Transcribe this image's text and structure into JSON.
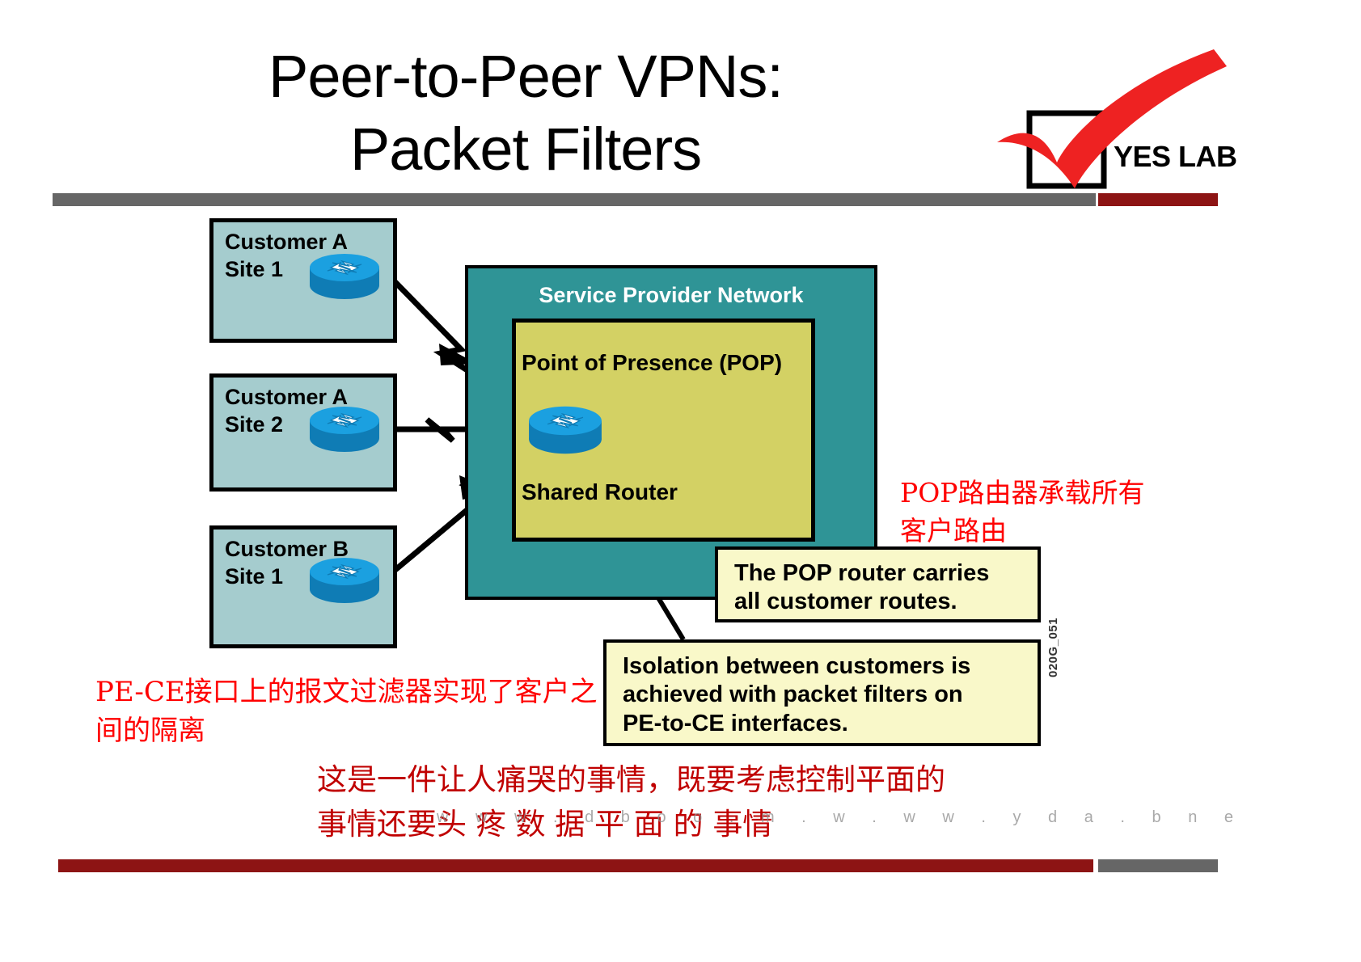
{
  "slide": {
    "title_line1": "Peer-to-Peer VPNs:",
    "title_line2": "Packet Filters",
    "slide_code": "020G_051",
    "watermark": "w w w . d b o o . m . w . w w . y d a . b n e"
  },
  "logo": {
    "text": "YES LAB",
    "accent_color": "#ee2222",
    "box_color": "#000000"
  },
  "rules": {
    "header_left_color": "#666666",
    "header_right_color": "#8d1414",
    "footer_left_color": "#8d1414",
    "footer_right_color": "#666666"
  },
  "diagram": {
    "customers": [
      {
        "label": "Customer A\nSite 1",
        "icon": "router-icon"
      },
      {
        "label": "Customer A\nSite 2",
        "icon": "router-icon"
      },
      {
        "label": "Customer B\nSite 1",
        "icon": "router-icon"
      }
    ],
    "sp_network_label": "Service Provider Network",
    "pop_label": "Point of Presence (POP)",
    "shared_router_label": "Shared Router",
    "shared_router_icon": "router-icon",
    "colors": {
      "customer_box": "#a5ccce",
      "sp_network": "#2f9496",
      "pop_box": "#d3d164",
      "callout": "#f9f8c9",
      "router_top": "#1ba0e0",
      "router_body": "#0f7cb5"
    }
  },
  "callouts": [
    {
      "id": "pop-routes",
      "text": "The POP router carries\nall customer routes."
    },
    {
      "id": "isolation",
      "text": "Isolation between customers is\nachieved with packet filters on\nPE-to-CE interfaces."
    }
  ],
  "annotations": {
    "pop_note_cn": "POP路由器承载所有\n客户路由",
    "pece_note_cn": "PE-CE接口上的报文过滤器实现了客户之\n间的隔离",
    "bottom_note_cn": "这是一件让人痛哭的事情，既要考虑控制平面的\n事情还要头 疼 数 据 平 面 的 事情",
    "note_color": "#ff0000"
  }
}
